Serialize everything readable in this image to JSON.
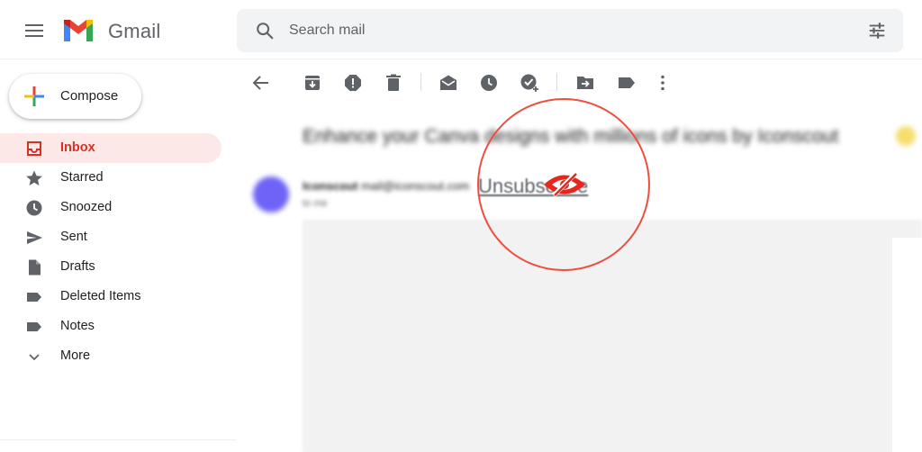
{
  "header": {
    "app_name": "Gmail",
    "search": {
      "placeholder": "Search mail"
    }
  },
  "sidebar": {
    "compose_label": "Compose",
    "items": [
      {
        "label": "Inbox",
        "icon": "inbox-icon",
        "active": true
      },
      {
        "label": "Starred",
        "icon": "star-icon"
      },
      {
        "label": "Snoozed",
        "icon": "clock-icon"
      },
      {
        "label": "Sent",
        "icon": "send-icon"
      },
      {
        "label": "Drafts",
        "icon": "draft-icon"
      },
      {
        "label": "Deleted Items",
        "icon": "label-icon"
      },
      {
        "label": "Notes",
        "icon": "label-icon"
      },
      {
        "label": "More",
        "icon": "chevron-down-icon"
      }
    ]
  },
  "toolbar": {
    "buttons": [
      "back-icon",
      "archive-icon",
      "report-spam-icon",
      "delete-icon",
      "mark-unread-icon",
      "snooze-icon",
      "add-to-tasks-icon",
      "move-to-icon",
      "label-icon",
      "more-vert-icon"
    ]
  },
  "email": {
    "subject": "Enhance your Canva designs with millions of icons by Iconscout",
    "sender_name": "Iconscout",
    "sender_email": "mail@iconscout.com",
    "to_line": "to me",
    "unsubscribe": "Unsubscribe"
  },
  "colors": {
    "accent": "#d93025",
    "active_bg": "#fce8e6",
    "highlight_circle": "#ef4e3f",
    "eye_icon": "#e8261b"
  }
}
